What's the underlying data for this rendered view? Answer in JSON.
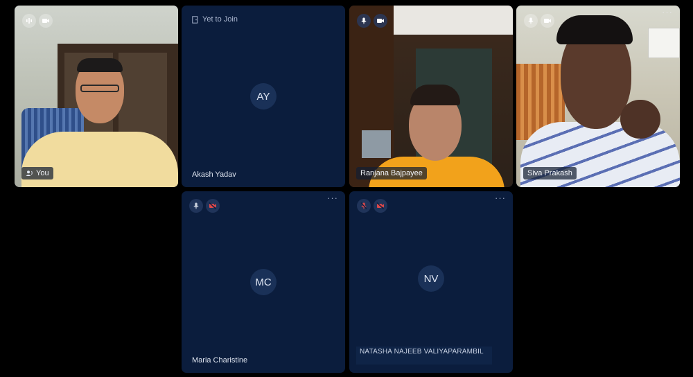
{
  "participants": [
    {
      "name": "You",
      "video": true
    },
    {
      "name": "Akash Yadav",
      "initials": "AY",
      "status": "Yet to Join"
    },
    {
      "name": "Ranjana Bajpayee",
      "video": true
    },
    {
      "name": "Siva Prakash",
      "video": true
    },
    {
      "name": "Maria Charistine",
      "initials": "MC",
      "mic": "off",
      "camera": "off"
    },
    {
      "name": "NATASHA NAJEEB VALIYAPARAMBIL",
      "initials": "NV",
      "mic": "off",
      "camera": "off"
    }
  ],
  "more_label": "···",
  "colors": {
    "tile_bg": "#0b1d3d",
    "page_bg": "#000000",
    "muted_red": "#d9484b"
  }
}
